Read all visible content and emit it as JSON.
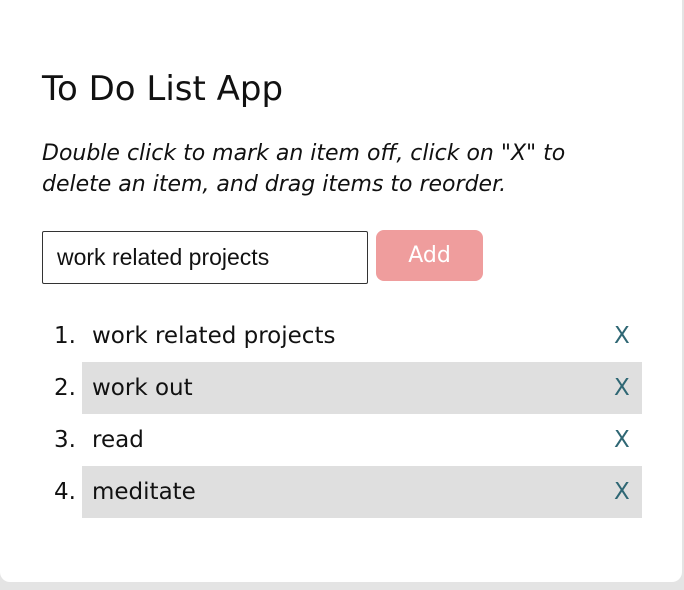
{
  "app": {
    "title": "To Do List App",
    "instructions": "Double click to mark an item off, click on \"X\" to delete an item, and drag items to reorder."
  },
  "form": {
    "input_value": "work related projects",
    "add_label": "Add"
  },
  "todos": [
    {
      "number": "1.",
      "text": "work related projects",
      "delete_label": "X"
    },
    {
      "number": "2.",
      "text": "work out",
      "delete_label": "X"
    },
    {
      "number": "3.",
      "text": "read",
      "delete_label": "X"
    },
    {
      "number": "4.",
      "text": "meditate",
      "delete_label": "X"
    }
  ],
  "colors": {
    "add_button": "#ef9d9d",
    "delete_x": "#2f6774",
    "alternate_row": "#dfdfdf"
  }
}
